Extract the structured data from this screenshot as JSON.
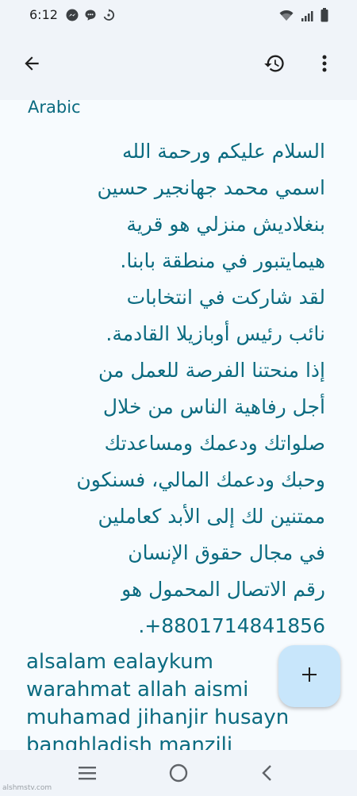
{
  "status_bar": {
    "time": "6:12",
    "left_icons": [
      "messenger-icon",
      "chat-bubble-icon",
      "sync-icon"
    ],
    "right_icons": [
      "wifi-icon",
      "signal-icon",
      "battery-icon"
    ]
  },
  "app_bar": {
    "back_icon": "arrow-left-icon",
    "history_icon": "history-icon",
    "more_icon": "more-vert-icon"
  },
  "content": {
    "language_label": "Arabic",
    "arabic_lines": [
      "السلام عليكم ورحمة الله",
      "اسمي محمد جهانجير حسين",
      "بنغلاديش منزلي هو قرية",
      "هيمايتبور في منطقة بابنا.",
      "لقد شاركت في انتخابات",
      "نائب رئيس أوبازيلا القادمة.",
      "إذا منحتنا الفرصة للعمل من",
      "أجل رفاهية الناس من خلال",
      "صلواتك ودعمك ومساعدتك",
      "وحبك ودعمك المالي، فسنكون",
      "ممتنين لك إلى الأبد كعاملين",
      "في مجال حقوق الإنسان",
      "رقم الاتصال المحمول هو",
      "8801714841856+."
    ],
    "transliteration_lines": [
      "alsalam ealaykum",
      "warahmat allah aismi",
      "muhamad jihanjir husayn",
      "banghladish manzili"
    ]
  },
  "fab": {
    "icon": "plus-icon"
  },
  "nav_bar": {
    "recents_icon": "menu-lines-icon",
    "home_icon": "circle-home-icon",
    "back_icon": "chevron-left-icon"
  },
  "watermark": "alshmstv.com",
  "colors": {
    "accent_text": "#0b6b80",
    "background": "#f0f4f9",
    "content_background": "#f7fbfe",
    "fab_background": "#c8e6fb"
  }
}
